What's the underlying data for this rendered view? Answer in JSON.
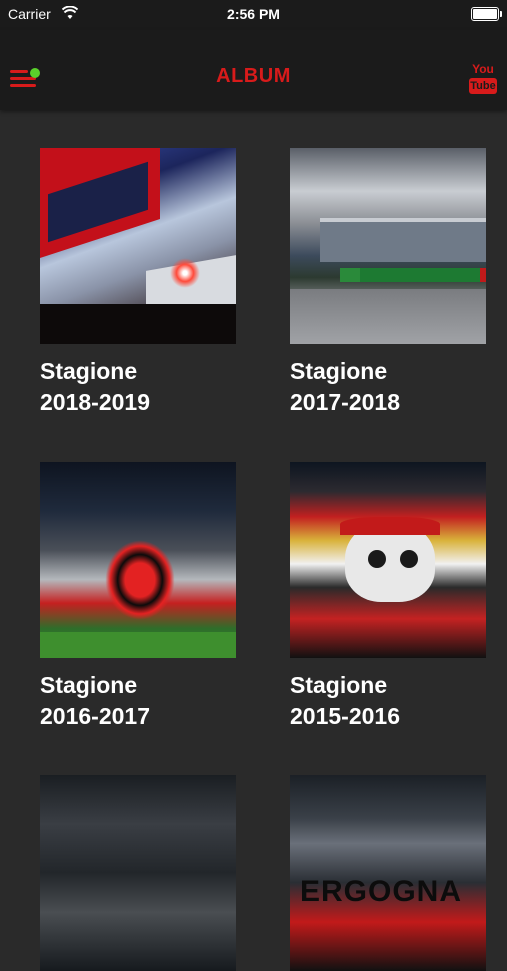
{
  "status_bar": {
    "carrier": "Carrier",
    "time": "2:56 PM",
    "battery_level": 1.0
  },
  "nav": {
    "title": "ALBUM",
    "menu_icon": "hamburger-menu-icon",
    "youtube_icon": "youtube-icon",
    "youtube_you": "You",
    "youtube_tube": "Tube"
  },
  "colors": {
    "accent": "#d81b1b",
    "badge": "#5ad12b",
    "background": "#2a2a2a",
    "bar": "#1b1b1b"
  },
  "albums": [
    {
      "line1": "Stagione",
      "line2": "2018-2019"
    },
    {
      "line1": "Stagione",
      "line2": "2017-2018"
    },
    {
      "line1": "Stagione",
      "line2": "2016-2017"
    },
    {
      "line1": "Stagione",
      "line2": "2015-2016"
    },
    {
      "line1": "",
      "line2": ""
    },
    {
      "line1": "",
      "line2": ""
    }
  ],
  "thumb_texts": {
    "t6": "ERGOGNA"
  }
}
